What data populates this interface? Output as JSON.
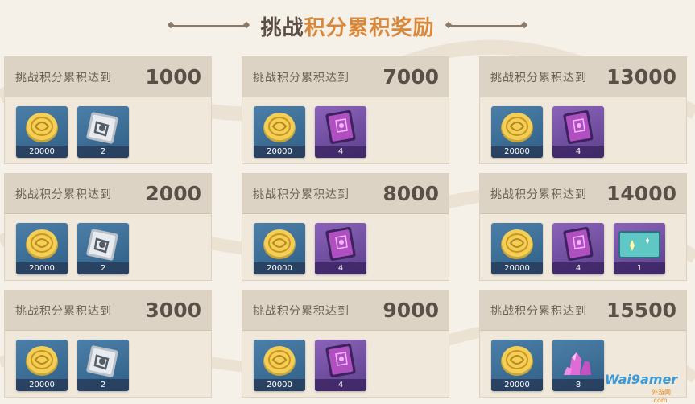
{
  "title": {
    "part1": "挑战",
    "part2": "积分累积奖励"
  },
  "colors": {
    "accent": "#d9873a",
    "title_dark": "#5b4f45"
  },
  "tiers": [
    {
      "label": "挑战积分累积达到",
      "value": "1000",
      "rewards": [
        {
          "icon": "mora-coin-icon",
          "count": "20000",
          "bg": "blue"
        },
        {
          "icon": "silver-book-icon",
          "count": "2",
          "bg": "blue"
        }
      ]
    },
    {
      "label": "挑战积分累积达到",
      "value": "7000",
      "rewards": [
        {
          "icon": "mora-coin-icon",
          "count": "20000",
          "bg": "blue"
        },
        {
          "icon": "purple-book-icon",
          "count": "4",
          "bg": "purple"
        }
      ]
    },
    {
      "label": "挑战积分累积达到",
      "value": "13000",
      "rewards": [
        {
          "icon": "mora-coin-icon",
          "count": "20000",
          "bg": "blue"
        },
        {
          "icon": "purple-book-icon",
          "count": "4",
          "bg": "purple"
        }
      ]
    },
    {
      "label": "挑战积分累积达到",
      "value": "2000",
      "rewards": [
        {
          "icon": "mora-coin-icon",
          "count": "20000",
          "bg": "blue"
        },
        {
          "icon": "silver-book-icon",
          "count": "2",
          "bg": "blue"
        }
      ]
    },
    {
      "label": "挑战积分累积达到",
      "value": "8000",
      "rewards": [
        {
          "icon": "mora-coin-icon",
          "count": "20000",
          "bg": "blue"
        },
        {
          "icon": "purple-book-icon",
          "count": "4",
          "bg": "purple"
        }
      ]
    },
    {
      "label": "挑战积分累积达到",
      "value": "14000",
      "rewards": [
        {
          "icon": "mora-coin-icon",
          "count": "20000",
          "bg": "blue"
        },
        {
          "icon": "purple-book-icon",
          "count": "4",
          "bg": "purple"
        },
        {
          "icon": "namecard-icon",
          "count": "1",
          "bg": "purple"
        }
      ]
    },
    {
      "label": "挑战积分累积达到",
      "value": "3000",
      "rewards": [
        {
          "icon": "mora-coin-icon",
          "count": "20000",
          "bg": "blue"
        },
        {
          "icon": "silver-book-icon",
          "count": "2",
          "bg": "blue"
        }
      ]
    },
    {
      "label": "挑战积分累积达到",
      "value": "9000",
      "rewards": [
        {
          "icon": "mora-coin-icon",
          "count": "20000",
          "bg": "blue"
        },
        {
          "icon": "purple-book-icon",
          "count": "4",
          "bg": "purple"
        }
      ]
    },
    {
      "label": "挑战积分累积达到",
      "value": "15500",
      "rewards": [
        {
          "icon": "mora-coin-icon",
          "count": "20000",
          "bg": "blue"
        },
        {
          "icon": "crystal-icon",
          "count": "8",
          "bg": "blue"
        }
      ]
    }
  ],
  "watermark": {
    "text": "Wai9amer",
    "sub": "外游网 .com"
  }
}
